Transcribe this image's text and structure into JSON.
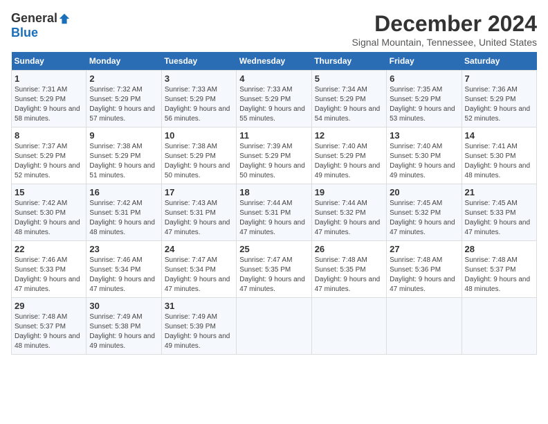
{
  "header": {
    "logo_general": "General",
    "logo_blue": "Blue",
    "month_title": "December 2024",
    "location": "Signal Mountain, Tennessee, United States"
  },
  "weekdays": [
    "Sunday",
    "Monday",
    "Tuesday",
    "Wednesday",
    "Thursday",
    "Friday",
    "Saturday"
  ],
  "weeks": [
    [
      {
        "day": "1",
        "sunrise": "7:31 AM",
        "sunset": "5:29 PM",
        "daylight": "9 hours and 58 minutes."
      },
      {
        "day": "2",
        "sunrise": "7:32 AM",
        "sunset": "5:29 PM",
        "daylight": "9 hours and 57 minutes."
      },
      {
        "day": "3",
        "sunrise": "7:33 AM",
        "sunset": "5:29 PM",
        "daylight": "9 hours and 56 minutes."
      },
      {
        "day": "4",
        "sunrise": "7:33 AM",
        "sunset": "5:29 PM",
        "daylight": "9 hours and 55 minutes."
      },
      {
        "day": "5",
        "sunrise": "7:34 AM",
        "sunset": "5:29 PM",
        "daylight": "9 hours and 54 minutes."
      },
      {
        "day": "6",
        "sunrise": "7:35 AM",
        "sunset": "5:29 PM",
        "daylight": "9 hours and 53 minutes."
      },
      {
        "day": "7",
        "sunrise": "7:36 AM",
        "sunset": "5:29 PM",
        "daylight": "9 hours and 52 minutes."
      }
    ],
    [
      {
        "day": "8",
        "sunrise": "7:37 AM",
        "sunset": "5:29 PM",
        "daylight": "9 hours and 52 minutes."
      },
      {
        "day": "9",
        "sunrise": "7:38 AM",
        "sunset": "5:29 PM",
        "daylight": "9 hours and 51 minutes."
      },
      {
        "day": "10",
        "sunrise": "7:38 AM",
        "sunset": "5:29 PM",
        "daylight": "9 hours and 50 minutes."
      },
      {
        "day": "11",
        "sunrise": "7:39 AM",
        "sunset": "5:29 PM",
        "daylight": "9 hours and 50 minutes."
      },
      {
        "day": "12",
        "sunrise": "7:40 AM",
        "sunset": "5:29 PM",
        "daylight": "9 hours and 49 minutes."
      },
      {
        "day": "13",
        "sunrise": "7:40 AM",
        "sunset": "5:30 PM",
        "daylight": "9 hours and 49 minutes."
      },
      {
        "day": "14",
        "sunrise": "7:41 AM",
        "sunset": "5:30 PM",
        "daylight": "9 hours and 48 minutes."
      }
    ],
    [
      {
        "day": "15",
        "sunrise": "7:42 AM",
        "sunset": "5:30 PM",
        "daylight": "9 hours and 48 minutes."
      },
      {
        "day": "16",
        "sunrise": "7:42 AM",
        "sunset": "5:31 PM",
        "daylight": "9 hours and 48 minutes."
      },
      {
        "day": "17",
        "sunrise": "7:43 AM",
        "sunset": "5:31 PM",
        "daylight": "9 hours and 47 minutes."
      },
      {
        "day": "18",
        "sunrise": "7:44 AM",
        "sunset": "5:31 PM",
        "daylight": "9 hours and 47 minutes."
      },
      {
        "day": "19",
        "sunrise": "7:44 AM",
        "sunset": "5:32 PM",
        "daylight": "9 hours and 47 minutes."
      },
      {
        "day": "20",
        "sunrise": "7:45 AM",
        "sunset": "5:32 PM",
        "daylight": "9 hours and 47 minutes."
      },
      {
        "day": "21",
        "sunrise": "7:45 AM",
        "sunset": "5:33 PM",
        "daylight": "9 hours and 47 minutes."
      }
    ],
    [
      {
        "day": "22",
        "sunrise": "7:46 AM",
        "sunset": "5:33 PM",
        "daylight": "9 hours and 47 minutes."
      },
      {
        "day": "23",
        "sunrise": "7:46 AM",
        "sunset": "5:34 PM",
        "daylight": "9 hours and 47 minutes."
      },
      {
        "day": "24",
        "sunrise": "7:47 AM",
        "sunset": "5:34 PM",
        "daylight": "9 hours and 47 minutes."
      },
      {
        "day": "25",
        "sunrise": "7:47 AM",
        "sunset": "5:35 PM",
        "daylight": "9 hours and 47 minutes."
      },
      {
        "day": "26",
        "sunrise": "7:48 AM",
        "sunset": "5:35 PM",
        "daylight": "9 hours and 47 minutes."
      },
      {
        "day": "27",
        "sunrise": "7:48 AM",
        "sunset": "5:36 PM",
        "daylight": "9 hours and 47 minutes."
      },
      {
        "day": "28",
        "sunrise": "7:48 AM",
        "sunset": "5:37 PM",
        "daylight": "9 hours and 48 minutes."
      }
    ],
    [
      {
        "day": "29",
        "sunrise": "7:48 AM",
        "sunset": "5:37 PM",
        "daylight": "9 hours and 48 minutes."
      },
      {
        "day": "30",
        "sunrise": "7:49 AM",
        "sunset": "5:38 PM",
        "daylight": "9 hours and 49 minutes."
      },
      {
        "day": "31",
        "sunrise": "7:49 AM",
        "sunset": "5:39 PM",
        "daylight": "9 hours and 49 minutes."
      },
      null,
      null,
      null,
      null
    ]
  ]
}
